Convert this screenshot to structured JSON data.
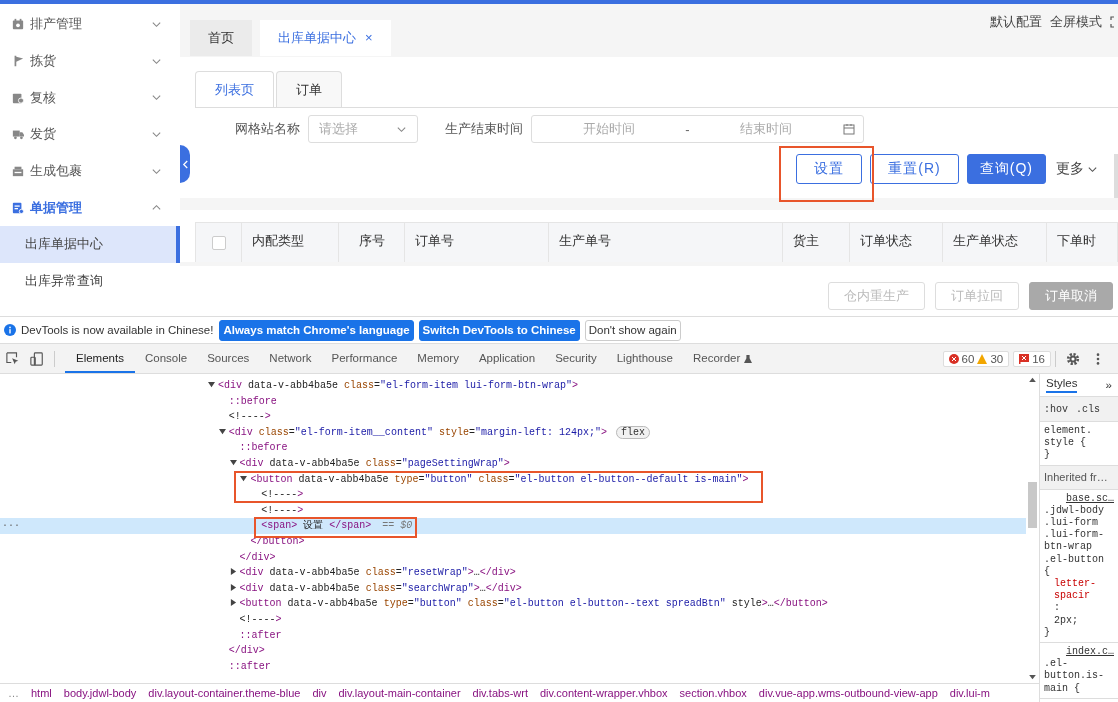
{
  "sidebar": {
    "items": [
      {
        "label": "排产管理",
        "expanded": false,
        "selected": false
      },
      {
        "label": "拣货",
        "expanded": false,
        "selected": false
      },
      {
        "label": "复核",
        "expanded": false,
        "selected": false
      },
      {
        "label": "发货",
        "expanded": false,
        "selected": false
      },
      {
        "label": "生成包裹",
        "expanded": false,
        "selected": false
      },
      {
        "label": "单据管理",
        "expanded": true,
        "selected": true,
        "children": [
          {
            "label": "出库单据中心",
            "selected": true
          },
          {
            "label": "出库异常查询",
            "selected": false
          }
        ]
      }
    ]
  },
  "page_tabs": [
    {
      "label": "首页",
      "selected": false
    },
    {
      "label": "出库单据中心",
      "selected": true,
      "close": "×"
    }
  ],
  "header_links": [
    "默认配置",
    "全屏模式"
  ],
  "sub_tabs": [
    {
      "label": "列表页",
      "selected": true
    },
    {
      "label": "订单",
      "selected": false
    }
  ],
  "filters": [
    {
      "kind": "select",
      "label": "网格站名称",
      "placeholder": "请选择"
    },
    {
      "kind": "daterange",
      "label": "生产结束时间",
      "start_placeholder": "开始时间",
      "separator": "-",
      "end_placeholder": "结束时间"
    }
  ],
  "actions": [
    {
      "label": "设置",
      "kind": "outline",
      "highlighted": true
    },
    {
      "label": "重置(R)",
      "kind": "outline"
    },
    {
      "label": "查询(Q)",
      "kind": "primary"
    },
    {
      "label": "更多",
      "kind": "dropdown"
    }
  ],
  "table": {
    "select_all": {
      "checked": false
    },
    "columns": [
      {
        "label": "内配类型"
      },
      {
        "label": "序号"
      },
      {
        "label": "订单号"
      },
      {
        "label": "生产单号"
      },
      {
        "label": "货主"
      },
      {
        "label": "订单状态"
      },
      {
        "label": "生产单状态"
      },
      {
        "label": "下单时"
      }
    ]
  },
  "bulk_actions": [
    {
      "label": "仓内重生产",
      "kind": "plain",
      "disabled": true
    },
    {
      "label": "订单拉回",
      "kind": "plain",
      "disabled": true
    },
    {
      "label": "订单取消",
      "kind": "filled",
      "disabled": true
    }
  ],
  "devtools": {
    "infobar": {
      "message": "DevTools is now available in Chinese!",
      "buttons": [
        {
          "label": "Always match Chrome's language",
          "kind": "primary"
        },
        {
          "label": "Switch DevTools to Chinese",
          "kind": "primary"
        },
        {
          "label": "Don't show again",
          "kind": "plain"
        }
      ]
    },
    "tabs": [
      {
        "label": "Elements",
        "selected": true
      },
      {
        "label": "Console",
        "selected": false
      },
      {
        "label": "Sources",
        "selected": false
      },
      {
        "label": "Network",
        "selected": false
      },
      {
        "label": "Performance",
        "selected": false
      },
      {
        "label": "Memory",
        "selected": false
      },
      {
        "label": "Application",
        "selected": false
      },
      {
        "label": "Security",
        "selected": false
      },
      {
        "label": "Lighthouse",
        "selected": false
      },
      {
        "label": "Recorder",
        "selected": false
      }
    ],
    "counters": {
      "errors": "60",
      "warnings": "30",
      "issues": "16"
    },
    "dom": [
      {
        "text": "<div data-v-abb4ba5e class=\"el-form-item lui-form-btn-wrap\">",
        "expanded": true,
        "selected": false,
        "highlighted": false,
        "children": [
          {
            "text": "::before",
            "selected": false,
            "highlighted": false
          },
          {
            "text": "<!---->",
            "selected": false,
            "highlighted": false
          },
          {
            "text": "<div class=\"el-form-item__content\" style=\"margin-left: 124px;\">",
            "badge": "flex",
            "expanded": true,
            "selected": false,
            "highlighted": false,
            "closing": "</div>",
            "children": [
              {
                "text": "::before",
                "selected": false,
                "highlighted": false
              },
              {
                "text": "<div data-v-abb4ba5e class=\"pageSettingWrap\">",
                "expanded": true,
                "selected": false,
                "highlighted": false,
                "closing": "</div>",
                "children": [
                  {
                    "text": "<button data-v-abb4ba5e type=\"button\" class=\"el-button el-button--default is-main\">",
                    "expanded": true,
                    "selected": false,
                    "highlighted": true,
                    "closing": "</button>",
                    "children": [
                      {
                        "text": "<!---->",
                        "selected": false,
                        "highlighted": false
                      },
                      {
                        "text": "<!---->",
                        "selected": false,
                        "highlighted": false
                      },
                      {
                        "text": "<span> 设置 </span>",
                        "suffix": "== $0",
                        "gutter": "···",
                        "selected": true,
                        "highlighted": true
                      }
                    ]
                  }
                ]
              },
              {
                "text": "<div data-v-abb4ba5e class=\"resetWrap\">…</div>",
                "expanded": false,
                "selected": false,
                "highlighted": false
              },
              {
                "text": "<div data-v-abb4ba5e class=\"searchWrap\">…</div>",
                "expanded": false,
                "selected": false,
                "highlighted": false
              },
              {
                "text": "<button data-v-abb4ba5e type=\"button\" class=\"el-button el-button--text spreadBtn\" style>…</button>",
                "expanded": false,
                "selected": false,
                "highlighted": false
              },
              {
                "text": "<!---->",
                "selected": false,
                "highlighted": false
              },
              {
                "text": "::after",
                "selected": false,
                "highlighted": false
              }
            ]
          },
          {
            "text": "::after",
            "selected": false,
            "highlighted": false
          }
        ]
      }
    ],
    "styles": {
      "tab": "Styles",
      "more": "»",
      "filters": [
        ":hov",
        ".cls"
      ],
      "sections": [
        [
          {
            "kind": "selector",
            "text": "element."
          },
          {
            "kind": "selector",
            "text": "style {"
          },
          {
            "kind": "brace",
            "text": "}"
          }
        ],
        [
          {
            "kind": "heading",
            "text": "Inherited fr…"
          }
        ],
        [
          {
            "kind": "source",
            "text": "base.sc…"
          },
          {
            "kind": "selector",
            "text": ".jdwl-body"
          },
          {
            "kind": "selector",
            "text": ".lui-form"
          },
          {
            "kind": "selector",
            "text": ".lui-form-"
          },
          {
            "kind": "selector",
            "text": "btn-wrap"
          },
          {
            "kind": "selector",
            "text": ".el-button"
          },
          {
            "kind": "brace",
            "text": "{"
          },
          {
            "kind": "property",
            "text": "letter-"
          },
          {
            "kind": "property",
            "text": "spacir"
          },
          {
            "kind": "punct",
            "text": ":"
          },
          {
            "kind": "value",
            "text": "2px;"
          },
          {
            "kind": "brace",
            "text": "}"
          }
        ],
        [
          {
            "kind": "source",
            "text": "index.c…"
          },
          {
            "kind": "selector",
            "text": ".el-"
          },
          {
            "kind": "selector",
            "text": "button.is-"
          },
          {
            "kind": "selector",
            "text": "main {"
          }
        ]
      ]
    },
    "breadcrumbs": [
      "…",
      "html",
      "body.jdwl-body",
      "div.layout-container.theme-blue",
      "div",
      "div.layout-main-container",
      "div.tabs-wrt",
      "div.content-wrapper.vhbox",
      "section.vhbox",
      "div.vue-app.wms-outbound-view-app",
      "div.lui-m"
    ]
  }
}
